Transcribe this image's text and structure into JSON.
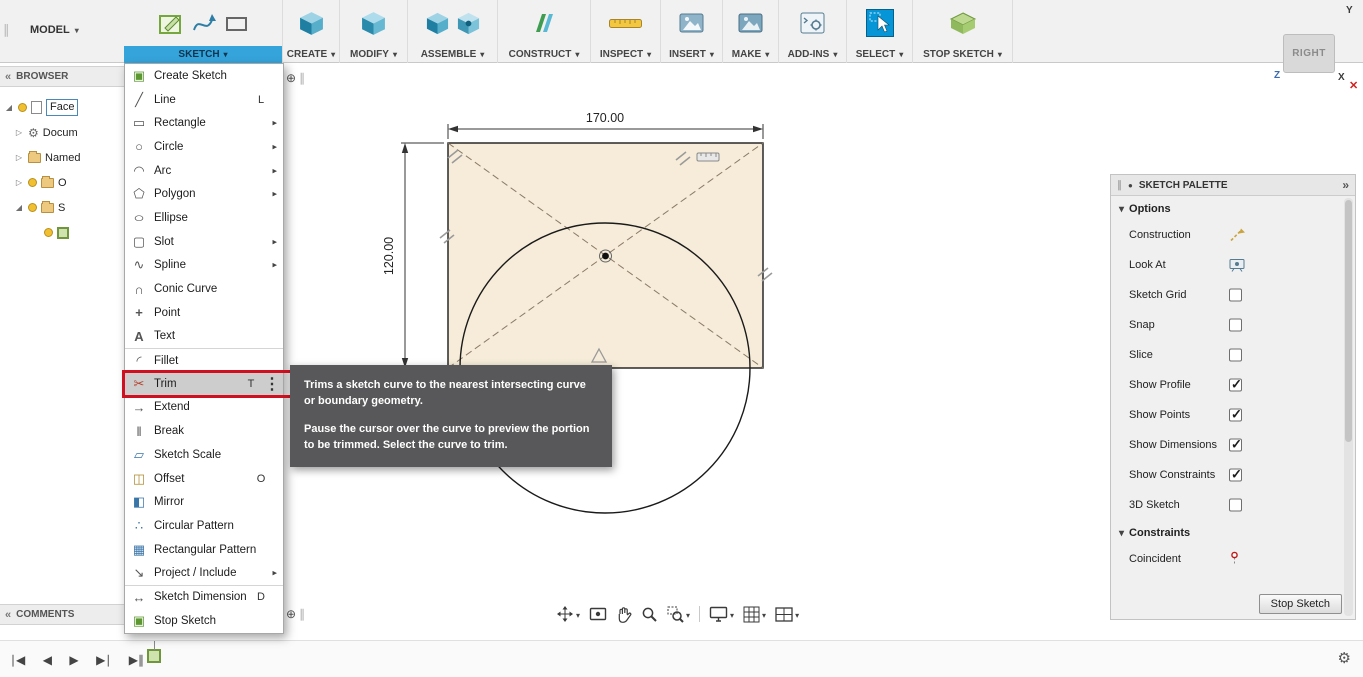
{
  "colors": {
    "accent_blue": "#0696d7",
    "tab_highlight": "#35a4da",
    "trim_highlight_border": "#cf1020",
    "tooltip_bg": "#58585a",
    "sketch_fill": "#f6ecd9"
  },
  "toolbar": {
    "model_label": "MODEL",
    "groups": [
      {
        "label": "SKETCH",
        "active": true
      },
      {
        "label": "CREATE"
      },
      {
        "label": "MODIFY"
      },
      {
        "label": "ASSEMBLE"
      },
      {
        "label": "CONSTRUCT"
      },
      {
        "label": "INSPECT"
      },
      {
        "label": "INSERT"
      },
      {
        "label": "MAKE"
      },
      {
        "label": "ADD-INS"
      },
      {
        "label": "SELECT"
      },
      {
        "label": "STOP SKETCH"
      }
    ]
  },
  "viewcube": {
    "face_label": "RIGHT",
    "axis_x": "X",
    "axis_y": "Y",
    "axis_z": "Z"
  },
  "browser": {
    "header": "BROWSER",
    "items": [
      {
        "label": "Face"
      },
      {
        "label": "Docum"
      },
      {
        "label": "Named"
      },
      {
        "label": "O"
      },
      {
        "label": "S"
      }
    ]
  },
  "menu": {
    "items": [
      {
        "label": "Create Sketch",
        "shortcut": "",
        "icon": "create-sketch-icon"
      },
      {
        "label": "Line",
        "shortcut": "L",
        "icon": "line-icon"
      },
      {
        "label": "Rectangle",
        "submenu": true,
        "icon": "rectangle-icon"
      },
      {
        "label": "Circle",
        "submenu": true,
        "icon": "circle-icon"
      },
      {
        "label": "Arc",
        "submenu": true,
        "icon": "arc-icon"
      },
      {
        "label": "Polygon",
        "submenu": true,
        "icon": "polygon-icon"
      },
      {
        "label": "Ellipse",
        "icon": "ellipse-icon"
      },
      {
        "label": "Slot",
        "submenu": true,
        "icon": "slot-icon"
      },
      {
        "label": "Spline",
        "submenu": true,
        "icon": "spline-icon"
      },
      {
        "label": "Conic Curve",
        "icon": "conic-curve-icon"
      },
      {
        "label": "Point",
        "icon": "point-icon"
      },
      {
        "label": "Text",
        "icon": "text-icon"
      },
      {
        "label": "Fillet",
        "icon": "fillet-icon"
      },
      {
        "label": "Trim",
        "shortcut": "T",
        "highlighted": true,
        "icon": "trim-icon"
      },
      {
        "label": "Extend",
        "icon": "extend-icon"
      },
      {
        "label": "Break",
        "icon": "break-icon"
      },
      {
        "label": "Sketch Scale",
        "icon": "sketch-scale-icon"
      },
      {
        "label": "Offset",
        "shortcut": "O",
        "icon": "offset-icon"
      },
      {
        "label": "Mirror",
        "icon": "mirror-icon"
      },
      {
        "label": "Circular Pattern",
        "icon": "circular-pattern-icon"
      },
      {
        "label": "Rectangular Pattern",
        "icon": "rectangular-pattern-icon"
      },
      {
        "label": "Project / Include",
        "submenu": true,
        "icon": "project-include-icon"
      },
      {
        "label": "Sketch Dimension",
        "shortcut": "D",
        "icon": "sketch-dimension-icon"
      },
      {
        "label": "Stop Sketch",
        "icon": "stop-sketch-icon"
      }
    ]
  },
  "tooltip": {
    "line1": "Trims a sketch curve to the nearest intersecting curve or boundary geometry.",
    "line2": "Pause the cursor over the curve to preview the portion to be trimmed. Select the curve to trim."
  },
  "canvas": {
    "dim_width": "170.00",
    "dim_height": "120.00"
  },
  "palette": {
    "header": "SKETCH PALETTE",
    "options_title": "Options",
    "options": [
      {
        "label": "Construction",
        "control": "construction-icon"
      },
      {
        "label": "Look At",
        "control": "look-at-icon"
      },
      {
        "label": "Sketch Grid",
        "checked": false
      },
      {
        "label": "Snap",
        "checked": false
      },
      {
        "label": "Slice",
        "checked": false
      },
      {
        "label": "Show Profile",
        "checked": true
      },
      {
        "label": "Show Points",
        "checked": true
      },
      {
        "label": "Show Dimensions",
        "checked": true
      },
      {
        "label": "Show Constraints",
        "checked": true
      },
      {
        "label": "3D Sketch",
        "checked": false
      }
    ],
    "constraints_title": "Constraints",
    "constraints": [
      {
        "label": "Coincident",
        "control": "coincident-icon"
      }
    ],
    "stop_button": "Stop Sketch"
  },
  "comments": {
    "header": "COMMENTS"
  }
}
